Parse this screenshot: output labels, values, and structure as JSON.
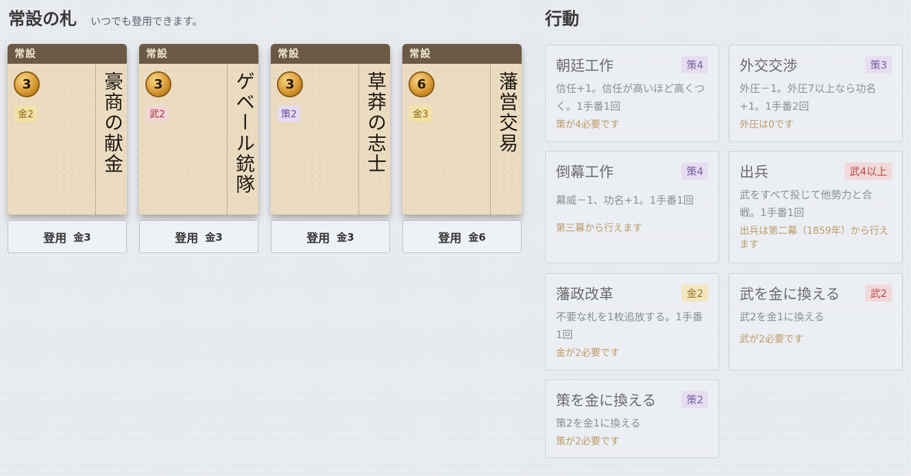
{
  "permanent": {
    "title": "常設の札",
    "subtitle": "いつでも登用できます。",
    "cards": [
      {
        "tag": "常設",
        "cost": "3",
        "req": "金2",
        "req_type": "gold",
        "name": "豪商の献金",
        "hire_label": "登用",
        "hire_cost": "金3"
      },
      {
        "tag": "常設",
        "cost": "3",
        "req": "武2",
        "req_type": "mil",
        "name": "ゲベール銃隊",
        "hire_label": "登用",
        "hire_cost": "金3"
      },
      {
        "tag": "常設",
        "cost": "3",
        "req": "策2",
        "req_type": "strat",
        "name": "草莽の志士",
        "hire_label": "登用",
        "hire_cost": "金3"
      },
      {
        "tag": "常設",
        "cost": "6",
        "req": "金3",
        "req_type": "gold",
        "name": "藩営交易",
        "hire_label": "登用",
        "hire_cost": "金6"
      }
    ]
  },
  "actions": {
    "title": "行動",
    "items": [
      {
        "title": "朝廷工作",
        "badge": "策4",
        "badge_type": "strat",
        "desc": "信任+1。信任が高いほど高くつく。1手番1回",
        "note": "策が4必要です"
      },
      {
        "title": "外交交渉",
        "badge": "策3",
        "badge_type": "strat",
        "desc": "外圧－1。外圧7以上なら功名+1。1手番2回",
        "note": "外圧は0です"
      },
      {
        "title": "倒幕工作",
        "badge": "策4",
        "badge_type": "strat",
        "desc": "幕威－1、功名+1。1手番1回",
        "note": "第三幕から行えます"
      },
      {
        "title": "出兵",
        "badge": "武4以上",
        "badge_type": "mil",
        "desc": "武をすべて投じて他勢力と合戦。1手番1回",
        "note": "出兵は第二幕（1859年）から行えます"
      },
      {
        "title": "藩政改革",
        "badge": "金2",
        "badge_type": "gold",
        "desc": "不要な札を1枚追放する。1手番1回",
        "note": "金が2必要です"
      },
      {
        "title": "武を金に換える",
        "badge": "武2",
        "badge_type": "mil",
        "desc": "武2を金1に換える",
        "note": "武が2必要です"
      },
      {
        "title": "策を金に換える",
        "badge": "策2",
        "badge_type": "strat",
        "desc": "策2を金1に換える",
        "note": "策が2必要です"
      }
    ]
  }
}
